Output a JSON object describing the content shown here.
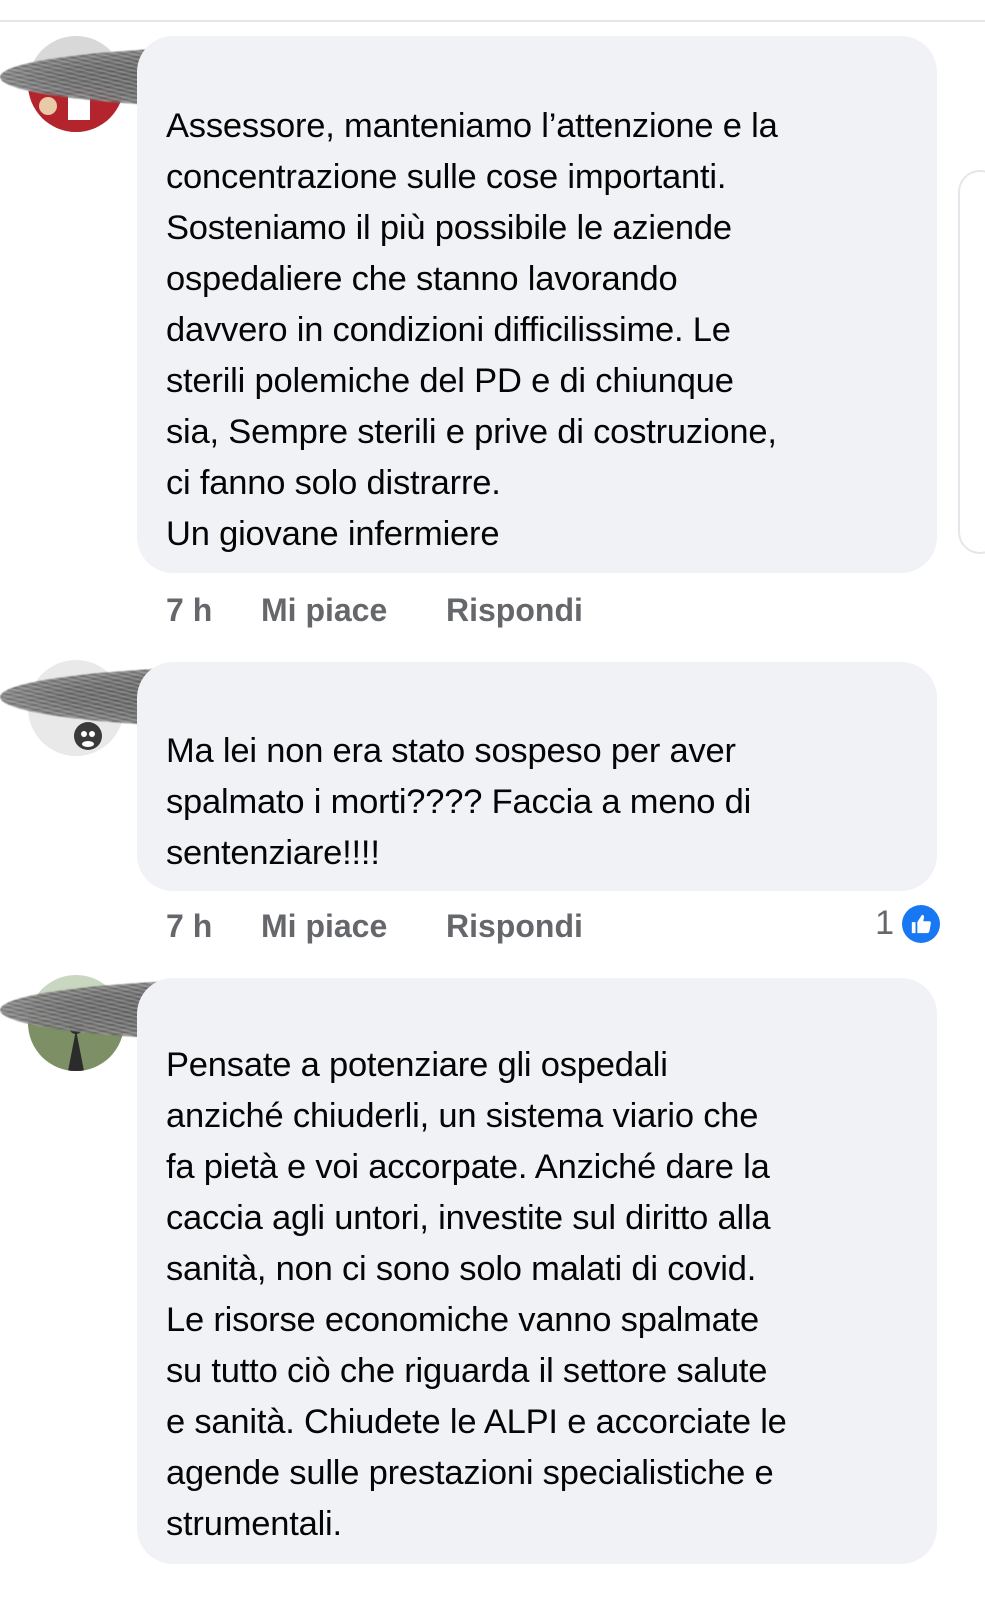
{
  "comments": [
    {
      "text": "Assessore, manteniamo l’attenzione e la\nconcentrazione sulle cose importanti.\nSosteniamo il più possibile le aziende\nospedaliere che stanno lavorando\ndavvero in condizioni difficilissime. Le\nsterili polemiche del PD e di chiunque\nsia, Sempre sterili e prive di costruzione,\nci fanno solo distrarre.\nUn giovane infermiere",
      "time": "7 h",
      "like_label": "Mi piace",
      "reply_label": "Rispondi"
    },
    {
      "text": "Ma lei non era stato sospeso per aver\nspalmato i morti???? Faccia a meno di\nsentenziare!!!!",
      "time": "7 h",
      "like_label": "Mi piace",
      "reply_label": "Rispondi",
      "reaction_count": "1",
      "reaction_icon": "thumbs-up-icon",
      "reaction_color": "#1877f2"
    },
    {
      "text": "Pensate a potenziare gli ospedali\nanziché chiuderli, un sistema viario che\nfa pietà e voi accorpate. Anziché dare la\ncaccia agli untori, investite sul diritto alla\nsanità, non ci sono solo malati di covid.\nLe risorse economiche vanno spalmate\nsu tutto ciò che riguarda il settore salute\ne sanità. Chiudete le ALPI e accorciate le\nagende sulle prestazioni specialistiche e\nstrumentali."
    }
  ],
  "colors": {
    "bubble_bg": "#f0f2f5",
    "text": "#050505",
    "meta_text": "#65676b",
    "accent": "#1877f2"
  }
}
